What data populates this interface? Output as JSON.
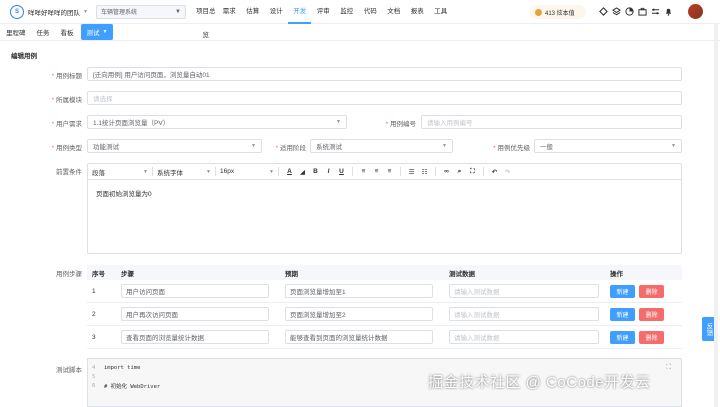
{
  "topbar": {
    "team_name": "咩咩好咩咩的团队",
    "project": "车辆管理系统",
    "nav": [
      "项目总览",
      "需求",
      "估算",
      "设计",
      "开发",
      "评审",
      "监控",
      "代码",
      "文档",
      "报表",
      "工具"
    ],
    "active_nav": "开发",
    "coins": "413 炫本值"
  },
  "tabs": {
    "items": [
      "里程碑",
      "任务",
      "看板"
    ],
    "active": "测试"
  },
  "form": {
    "section_title": "编辑用例",
    "title_label": "用例标题",
    "title_value": "[迁向用例] 用户访问页面，浏览量自动01",
    "module_label": "所属模块",
    "module_placeholder": "请选择",
    "req_label": "用户需求",
    "req_value": "1.1统计页面浏览量（PV）",
    "code_label": "用例编号",
    "code_placeholder": "请输入用例编号",
    "type_label": "用例类型",
    "type_value": "功能测试",
    "stage_label": "适用阶段",
    "stage_value": "系统测试",
    "priority_label": "用例优先级",
    "priority_value": "一般",
    "precond_label": "前置条件",
    "editor": {
      "para": "段落",
      "font": "系统字体",
      "size": "16px",
      "content": "页面初始浏览量为0"
    },
    "steps_label": "用例步骤",
    "steps_head": {
      "no": "序号",
      "step": "步骤",
      "expect": "预期",
      "data": "测试数据",
      "op": "操作"
    },
    "steps": [
      {
        "no": "1",
        "step": "用户访问页面",
        "expect": "页面浏览量增加至1",
        "data": "请输入测试数据",
        "new": "新建",
        "del": "删除"
      },
      {
        "no": "2",
        "step": "用户再次访问页面",
        "expect": "页面浏览量增加至2",
        "data": "请输入测试数据",
        "new": "新建",
        "del": "删除"
      },
      {
        "no": "3",
        "step": "查看页面的浏览量统计数据",
        "expect": "能够查看到页面的浏览量统计数据",
        "data": "请输入测试数据",
        "new": "新建",
        "del": "删除"
      }
    ],
    "script_label": "测试脚本",
    "script_lines": [
      {
        "ln": "4",
        "text": "import time"
      },
      {
        "ln": "5",
        "text": ""
      },
      {
        "ln": "6",
        "text": "# 初始化 WebDriver"
      }
    ]
  },
  "feedback": "反馈",
  "watermark": "掘金技术社区 @ CoCode开发云",
  "colors": {
    "primary": "#409eff",
    "danger": "#f56c6c",
    "coin": "#e6a23c"
  }
}
